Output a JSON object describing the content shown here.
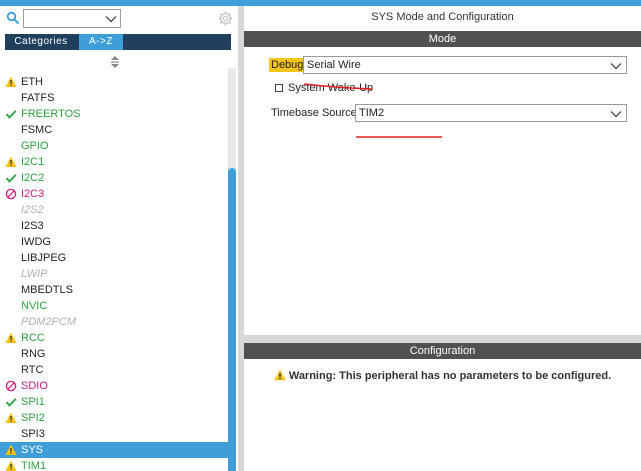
{
  "left_panel": {
    "search": {
      "value": "",
      "placeholder": ""
    },
    "tabs": [
      {
        "label": "Categories"
      },
      {
        "label": "A->Z",
        "active": true
      }
    ],
    "items": [
      {
        "label": "ETH",
        "status": "warning",
        "color": "normal"
      },
      {
        "label": "FATFS",
        "status": "none",
        "color": "normal"
      },
      {
        "label": "FREERTOS",
        "status": "check",
        "color": "green"
      },
      {
        "label": "FSMC",
        "status": "none",
        "color": "normal"
      },
      {
        "label": "GPIO",
        "status": "none",
        "color": "green"
      },
      {
        "label": "I2C1",
        "status": "warning",
        "color": "green"
      },
      {
        "label": "I2C2",
        "status": "check",
        "color": "green"
      },
      {
        "label": "I2C3",
        "status": "blocked",
        "color": "pink"
      },
      {
        "label": "I2S2",
        "status": "none",
        "color": "gray"
      },
      {
        "label": "I2S3",
        "status": "none",
        "color": "normal"
      },
      {
        "label": "IWDG",
        "status": "none",
        "color": "normal"
      },
      {
        "label": "LIBJPEG",
        "status": "none",
        "color": "normal"
      },
      {
        "label": "LWIP",
        "status": "none",
        "color": "gray"
      },
      {
        "label": "MBEDTLS",
        "status": "none",
        "color": "normal"
      },
      {
        "label": "NVIC",
        "status": "none",
        "color": "green"
      },
      {
        "label": "PDM2PCM",
        "status": "none",
        "color": "gray"
      },
      {
        "label": "RCC",
        "status": "warning",
        "color": "green"
      },
      {
        "label": "RNG",
        "status": "none",
        "color": "normal"
      },
      {
        "label": "RTC",
        "status": "none",
        "color": "normal"
      },
      {
        "label": "SDIO",
        "status": "blocked",
        "color": "pink"
      },
      {
        "label": "SPI1",
        "status": "check",
        "color": "green"
      },
      {
        "label": "SPI2",
        "status": "warning",
        "color": "green"
      },
      {
        "label": "SPI3",
        "status": "none",
        "color": "normal"
      },
      {
        "label": "SYS",
        "status": "warning",
        "color": "normal",
        "selected": true
      },
      {
        "label": "TIM1",
        "status": "warning",
        "color": "green"
      }
    ]
  },
  "right_panel": {
    "title": "SYS Mode and Configuration",
    "mode_header": "Mode",
    "debug": {
      "label": "Debug",
      "value": "Serial Wire"
    },
    "system_wakeup": {
      "label": "System Wake-Up",
      "checked": false
    },
    "timebase": {
      "label": "Timebase Source",
      "value": "TIM2"
    },
    "config_header": "Configuration",
    "warning_text": "Warning: This peripheral has no parameters to be configured."
  },
  "colors": {
    "accent": "#3f9ed7",
    "header_bg": "#515151",
    "tab_bg": "#1f3f5c",
    "warning_yellow": "#f4c518",
    "ok_green": "#2ba13d",
    "error_pink": "#cf1b7d",
    "annotation_red": "#e02020"
  }
}
